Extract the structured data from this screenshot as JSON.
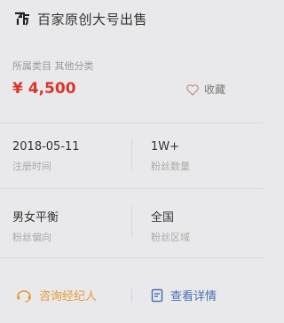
{
  "header": {
    "title": "百家原创大号出售",
    "logo_icon": "baijiahao-logo"
  },
  "category": "所属类目 其他分类",
  "price": "¥ 4,500",
  "favorite": {
    "label": "收藏",
    "icon": "heart-outline-icon"
  },
  "stats": [
    {
      "value": "2018-05-11",
      "label": "注册时间"
    },
    {
      "value": "1W+",
      "label": "粉丝数量"
    },
    {
      "value": "男女平衡",
      "label": "粉丝偏向"
    },
    {
      "value": "全国",
      "label": "粉丝区域"
    }
  ],
  "actions": {
    "consult": {
      "label": "咨询经纪人",
      "icon": "headset-icon"
    },
    "detail": {
      "label": "查看详情",
      "icon": "document-icon"
    }
  },
  "colors": {
    "price": "#d9362b",
    "consult": "#e69a3a",
    "detail": "#4a6fb5"
  }
}
